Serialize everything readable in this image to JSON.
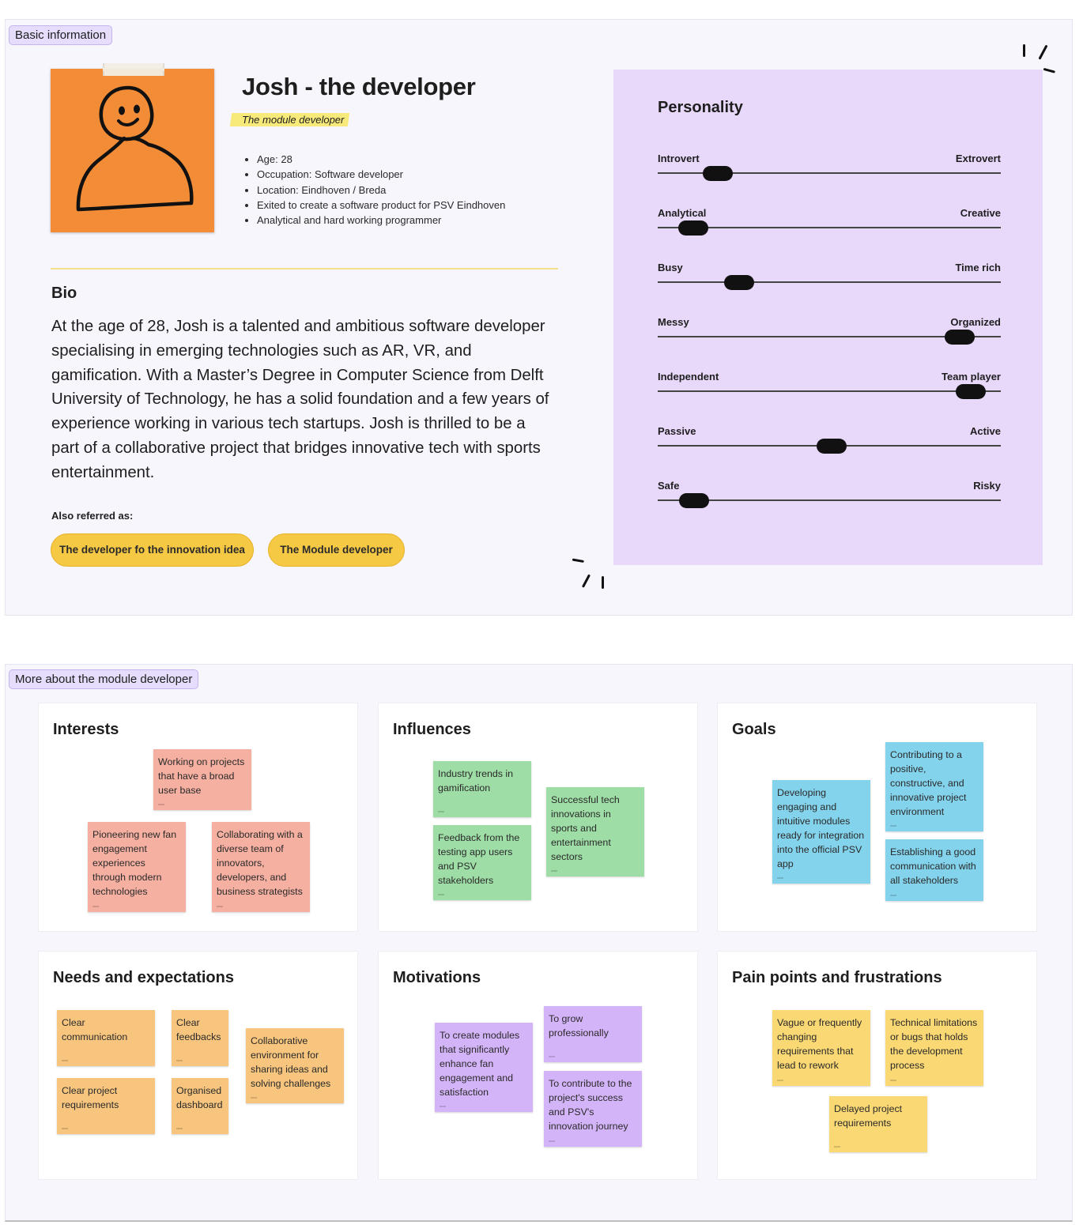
{
  "sections": {
    "basic_info_label": "Basic information",
    "more_about_label": "More about the module developer"
  },
  "persona": {
    "name": "Josh - the developer",
    "subtitle": "The module developer",
    "facts": [
      "Age: 28",
      "Occupation:  Software developer",
      "Location: Eindhoven / Breda",
      "Exited to create a software product for PSV Eindhoven",
      "Analytical and hard working programmer"
    ],
    "avatar_icon": "smiley-person-icon",
    "avatar_color": "#f28c36"
  },
  "bio": {
    "title": "Bio",
    "text": "At the age of 28, Josh is a talented and ambitious software developer specialising in emerging technologies such as AR, VR, and gamification. With a Master’s Degree in Computer Science from Delft University of Technology, he has a solid foundation and a few years of experience working in various tech startups. Josh is thrilled to be a part of a collaborative project that bridges innovative tech with sports entertainment.",
    "also_referred_label": "Also referred as:",
    "aliases": [
      "The developer fo the innovation idea",
      "The Module developer"
    ]
  },
  "personality": {
    "title": "Personality",
    "traits": [
      {
        "left": "Introvert",
        "right": "Extrovert",
        "value": 0.175
      },
      {
        "left": "Analytical",
        "right": "Creative",
        "value": 0.104
      },
      {
        "left": "Busy",
        "right": "Time rich",
        "value": 0.238
      },
      {
        "left": "Messy",
        "right": "Organized",
        "value": 0.881
      },
      {
        "left": "Independent",
        "right": "Team player",
        "value": 0.913
      },
      {
        "left": "Passive",
        "right": "Active",
        "value": 0.508
      },
      {
        "left": "Safe",
        "right": "Risky",
        "value": 0.106
      }
    ]
  },
  "cards": {
    "interests": {
      "title": "Interests",
      "notes": [
        "Working on projects that have a broad user base",
        "Pioneering new fan engagement experiences through modern technologies",
        "Collaborating with a diverse team of innovators, developers, and business strategists"
      ]
    },
    "influences": {
      "title": "Influences",
      "notes": [
        "Industry trends in gamification",
        "Feedback from the testing app users and PSV stakeholders",
        "Successful tech innovations in sports and entertainment sectors"
      ]
    },
    "goals": {
      "title": "Goals",
      "notes": [
        "Developing engaging and intuitive modules ready for integration into the official PSV app",
        "Contributing to a positive, constructive, and innovative project environment",
        "Establishing a good communication with all stakeholders"
      ]
    },
    "needs": {
      "title": "Needs and expectations",
      "notes": [
        "Clear communication",
        "Clear feedbacks",
        "Clear project requirements",
        "Organised dashboard",
        "Collaborative environment for sharing ideas and solving challenges"
      ]
    },
    "motivations": {
      "title": "Motivations",
      "notes": [
        "To create modules that significantly enhance fan engagement and satisfaction",
        "To grow professionally",
        "To contribute to the project's success and PSV's innovation journey"
      ]
    },
    "pain_points": {
      "title": "Pain points and frustrations",
      "notes": [
        "Vague or frequently changing requirements that lead to rework",
        "Technical limitations or bugs that holds the development process",
        "Delayed project requirements"
      ]
    }
  },
  "colors": {
    "personality_bg": "#e8d9fb",
    "interests": "#f5b0a1",
    "influences": "#9edda6",
    "goals": "#84d3ec",
    "needs": "#f7c57e",
    "motivations": "#d4b4f8",
    "pain_points": "#fad874",
    "alias_pill": "#f6c944"
  }
}
